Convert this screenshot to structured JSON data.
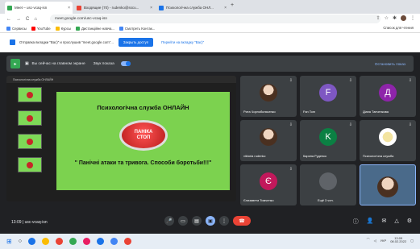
{
  "tabs": [
    {
      "label": "Meet – usc-vcaq-isn",
      "favicon": "#34a853",
      "active": true
    },
    {
      "label": "Входящие (70) - rudenko@sscu...",
      "favicon": "#ea4335",
      "active": false
    },
    {
      "label": "Психологічна служба ОНЛ...",
      "favicon": "#1a73e8",
      "active": false
    }
  ],
  "newtab": "+",
  "address": {
    "url": "meet.google.com/usc-vcaq-isn"
  },
  "nav": {
    "back": "←",
    "forward": "→",
    "reload": "C",
    "home": "⌂"
  },
  "bookmarks": [
    {
      "label": "Сервисы",
      "color": "#4285f4"
    },
    {
      "label": "YouTube",
      "color": "#ff0000"
    },
    {
      "label": "Курсы",
      "color": "#fbbc04"
    },
    {
      "label": "Дистанційне навча...",
      "color": "#34a853"
    },
    {
      "label": "Смотреть Контак...",
      "color": "#4285f4"
    }
  ],
  "bookmarks_right": "Список для чтения",
  "share": {
    "text": "Отправка вкладки \"Вас)\" и прослушив \"meet.google.com\"...",
    "primary": "Закрыть доступ",
    "secondary": "Перейти на вкладку \"Вас)\""
  },
  "banner": {
    "text": "Вы сейчас на главном экране",
    "sound": "Звук показа",
    "stop": "Остановить показ"
  },
  "presentation": {
    "toolbar": "Психологічна служба ОНЛАЙН",
    "slide_title": "Психологічна служба ОНЛАЙН",
    "button_line1": "ПАНІКА",
    "button_line2": "СТОП",
    "quote": "\" Панічні атаки та тривога. Способи боротьби!!!\""
  },
  "participants": [
    {
      "name": "Рита Чорнобильченко",
      "initial": "",
      "color": "photo"
    },
    {
      "name": "Fan Tom",
      "initial": "F",
      "color": "#7e57c2"
    },
    {
      "name": "Діана Тапченкова",
      "initial": "Д",
      "color": "#8e24aa"
    },
    {
      "name": "viktoria rudenko",
      "initial": "",
      "color": "photo"
    },
    {
      "name": "Карина Руденко",
      "initial": "K",
      "color": "#0b8043"
    },
    {
      "name": "Психологічна служба",
      "initial": "",
      "color": "logo"
    },
    {
      "name": "Єлизавета Тимченко",
      "initial": "Є",
      "color": "#c2185b"
    },
    {
      "name": "Ещё 3 чел.",
      "initial": "",
      "color": "#5f6368"
    },
    {
      "name": "",
      "initial": "",
      "color": "#4a6a8a"
    }
  ],
  "controls": {
    "time": "13:09",
    "separator": "|",
    "meeting_code": "usc-vcaq-isn",
    "mic": "🎤",
    "cam": "▭",
    "cc": "▤",
    "present": "▣",
    "more": "⋮",
    "leave": "☎",
    "info": "ⓘ",
    "people": "👤",
    "chat": "✉",
    "activities": "△",
    "lock": "⚙"
  },
  "taskbar": {
    "date": "08.02.2022",
    "clock": "13:09",
    "lang": "УКР",
    "icons": [
      "#1a73e8",
      "#fbbc04",
      "#ea4335",
      "#34a853",
      "#e91e63",
      "#1a73e8",
      "#4285f4",
      "#ea4335"
    ]
  }
}
